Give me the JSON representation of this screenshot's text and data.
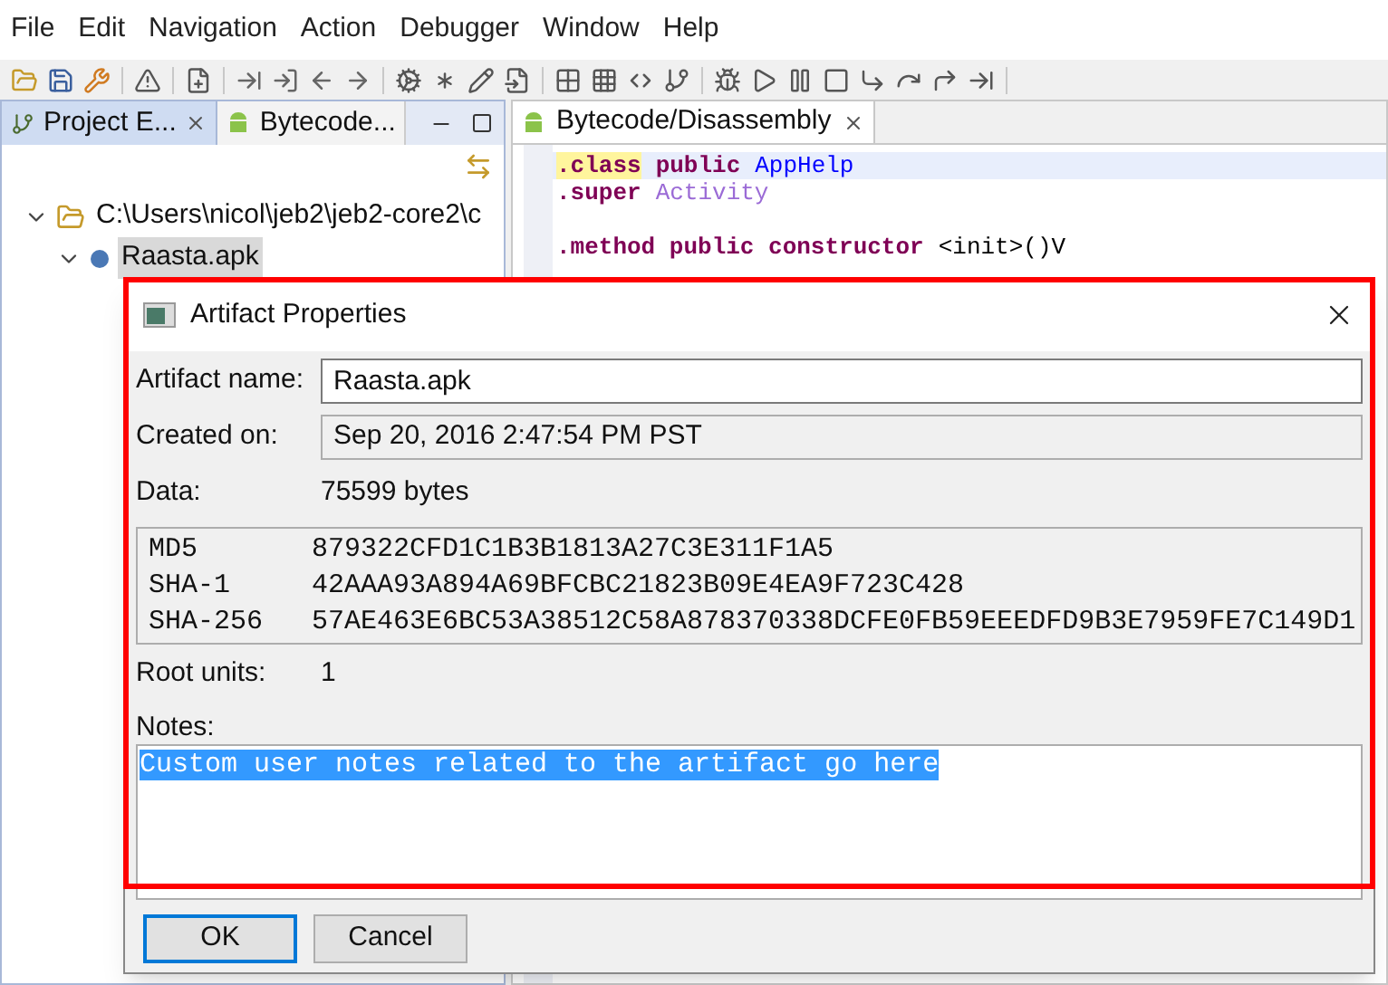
{
  "menu": [
    "File",
    "Edit",
    "Navigation",
    "Action",
    "Debugger",
    "Window",
    "Help"
  ],
  "left_pane": {
    "tabs": [
      {
        "label": "Project E...",
        "selected": true
      },
      {
        "label": "Bytecode...",
        "selected": false
      }
    ],
    "tree": [
      {
        "label": "C:\\Users\\nicol\\jeb2\\jeb2-core2\\c",
        "expanded": true,
        "selected": false,
        "children": [
          {
            "label": "Raasta.apk",
            "expanded": true,
            "selected": true
          }
        ]
      }
    ]
  },
  "editor": {
    "tabs": [
      {
        "label": "Bytecode/Disassembly",
        "selected": true
      }
    ],
    "lines": [
      {
        "current": true,
        "tokens": [
          {
            "text": ".class",
            "kind": "directive",
            "marked": true
          },
          {
            "text": "public",
            "kind": "keyword"
          },
          {
            "text": "AppHelp",
            "kind": "type"
          }
        ]
      },
      {
        "current": false,
        "tokens": [
          {
            "text": ".super",
            "kind": "directive"
          },
          {
            "text": "Activity",
            "kind": "reference"
          }
        ]
      },
      {
        "current": false
      },
      {
        "current": false,
        "tokens": [
          {
            "text": ".method public constructor",
            "kind": "directive"
          },
          {
            "text": "<init>()V",
            "kind": "plain"
          }
        ]
      }
    ]
  },
  "dialog": {
    "title": "Artifact Properties",
    "artifact_name": {
      "label": "Artifact name:",
      "value": "Raasta.apk"
    },
    "created_on": {
      "label": "Created on:",
      "value": "Sep 20, 2016 2:47:54 PM PST"
    },
    "data": {
      "label": "Data:",
      "value": "75599 bytes"
    },
    "hashes": [
      {
        "algorithm": "MD5",
        "value": "879322CFD1C1B3B1813A27C3E311F1A5"
      },
      {
        "algorithm": "SHA-1",
        "value": "42AAA93A894A69BFCBC21823B09E4EA9F723C428"
      },
      {
        "algorithm": "SHA-256",
        "value": "57AE463E6BC53A38512C58A878370338DCFE0FB59EEEDFD9B3E7959FE7C149D1"
      }
    ],
    "root_units": {
      "label": "Root units:",
      "value": "1"
    },
    "notes": {
      "label": "Notes:",
      "value": "Custom user notes related to the artifact go here",
      "selected": true
    },
    "buttons": [
      {
        "label": "OK",
        "default": true
      },
      {
        "label": "Cancel",
        "default": false
      }
    ]
  }
}
